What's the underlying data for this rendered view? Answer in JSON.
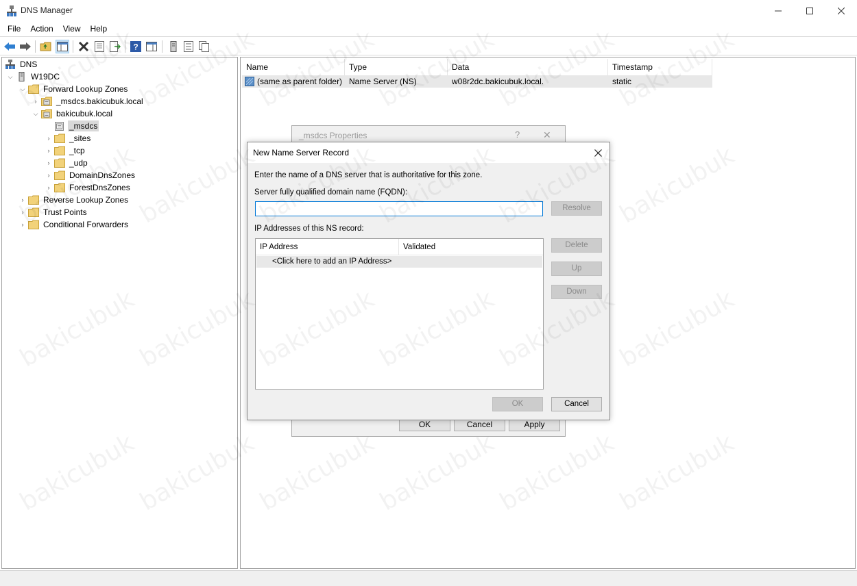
{
  "window": {
    "title": "DNS Manager",
    "controls": {
      "minimize": "—",
      "maximize": "☐",
      "close": "✕"
    }
  },
  "menu": [
    "File",
    "Action",
    "View",
    "Help"
  ],
  "tree": {
    "root": "DNS",
    "server": "W19DC",
    "forward_zones": "Forward Lookup Zones",
    "msdcs_zone": "_msdcs.bakicubuk.local",
    "domain_zone": "bakicubuk.local",
    "children": [
      "_msdcs",
      "_sites",
      "_tcp",
      "_udp",
      "DomainDnsZones",
      "ForestDnsZones"
    ],
    "reverse_zones": "Reverse Lookup Zones",
    "trust_points": "Trust Points",
    "conditional_forwarders": "Conditional Forwarders"
  },
  "list": {
    "columns": [
      "Name",
      "Type",
      "Data",
      "Timestamp"
    ],
    "rows": [
      {
        "name": "(same as parent folder)",
        "type": "Name Server (NS)",
        "data": "w08r2dc.bakicubuk.local.",
        "timestamp": "static"
      }
    ]
  },
  "props_dialog": {
    "title": "_msdcs Properties",
    "help": "?",
    "close": "✕",
    "ok": "OK",
    "cancel": "Cancel",
    "apply": "Apply"
  },
  "ns_dialog": {
    "title": "New Name Server Record",
    "close": "✕",
    "instruction": "Enter the name of a DNS server that is authoritative for this zone.",
    "fqdn_label": "Server fully qualified domain name (FQDN):",
    "fqdn_value": "",
    "resolve": "Resolve",
    "ip_label": "IP Addresses of this NS record:",
    "ip_columns": [
      "IP Address",
      "Validated"
    ],
    "add_ip": "<Click here to add an IP Address>",
    "delete": "Delete",
    "up": "Up",
    "down": "Down",
    "ok": "OK",
    "cancel": "Cancel"
  },
  "watermark": "bakicubuk"
}
